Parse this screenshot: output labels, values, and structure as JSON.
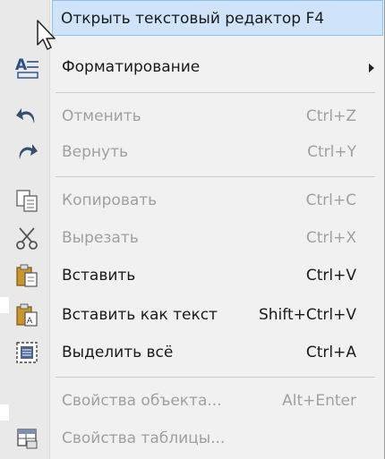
{
  "menu": {
    "items": [
      {
        "label": "Открыть текстовый редактор F4",
        "shortcut": "",
        "state": "highlighted",
        "icon": "none"
      },
      {
        "label": "Форматирование",
        "shortcut": "",
        "state": "enabled",
        "icon": "text-format-icon",
        "submenu": true
      },
      {
        "label": "Отменить",
        "shortcut": "Ctrl+Z",
        "state": "disabled",
        "icon": "undo-icon"
      },
      {
        "label": "Вернуть",
        "shortcut": "Ctrl+Y",
        "state": "disabled",
        "icon": "redo-icon"
      },
      {
        "label": "Копировать",
        "shortcut": "Ctrl+C",
        "state": "disabled",
        "icon": "copy-icon"
      },
      {
        "label": "Вырезать",
        "shortcut": "Ctrl+X",
        "state": "disabled",
        "icon": "scissors-icon"
      },
      {
        "label": "Вставить",
        "shortcut": "Ctrl+V",
        "state": "enabled",
        "icon": "paste-icon"
      },
      {
        "label": "Вставить как текст",
        "shortcut": "Shift+Ctrl+V",
        "state": "enabled",
        "icon": "paste-text-icon"
      },
      {
        "label": "Выделить всё",
        "shortcut": "Ctrl+A",
        "state": "enabled",
        "icon": "select-all-icon"
      },
      {
        "label": "Свойства объекта...",
        "shortcut": "Alt+Enter",
        "state": "disabled",
        "icon": "none"
      },
      {
        "label": "Свойства таблицы...",
        "shortcut": "",
        "state": "disabled",
        "icon": "table-properties-icon"
      }
    ]
  },
  "colors": {
    "menu_bg": "#f1f1f1",
    "highlight_bg": "#cfe3fb",
    "highlight_border": "#90bff0",
    "text": "#1a1a1a",
    "disabled_text": "#a0a0a0"
  }
}
